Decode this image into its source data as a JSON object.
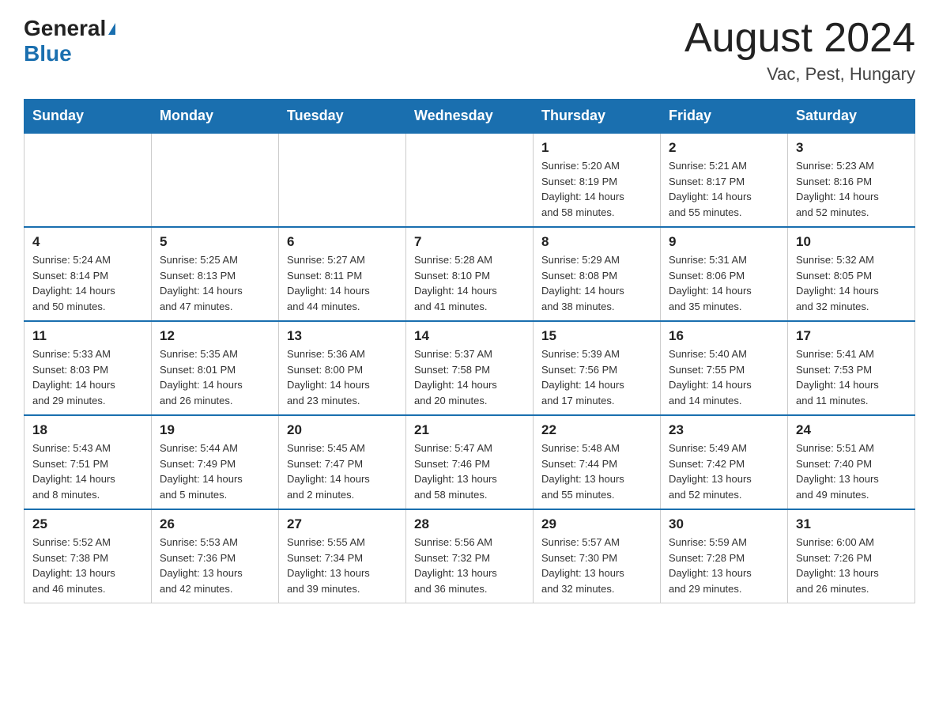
{
  "header": {
    "logo_general": "General",
    "logo_blue": "Blue",
    "month_title": "August 2024",
    "location": "Vac, Pest, Hungary"
  },
  "days_of_week": [
    "Sunday",
    "Monday",
    "Tuesday",
    "Wednesday",
    "Thursday",
    "Friday",
    "Saturday"
  ],
  "weeks": [
    [
      {
        "day": "",
        "info": ""
      },
      {
        "day": "",
        "info": ""
      },
      {
        "day": "",
        "info": ""
      },
      {
        "day": "",
        "info": ""
      },
      {
        "day": "1",
        "info": "Sunrise: 5:20 AM\nSunset: 8:19 PM\nDaylight: 14 hours\nand 58 minutes."
      },
      {
        "day": "2",
        "info": "Sunrise: 5:21 AM\nSunset: 8:17 PM\nDaylight: 14 hours\nand 55 minutes."
      },
      {
        "day": "3",
        "info": "Sunrise: 5:23 AM\nSunset: 8:16 PM\nDaylight: 14 hours\nand 52 minutes."
      }
    ],
    [
      {
        "day": "4",
        "info": "Sunrise: 5:24 AM\nSunset: 8:14 PM\nDaylight: 14 hours\nand 50 minutes."
      },
      {
        "day": "5",
        "info": "Sunrise: 5:25 AM\nSunset: 8:13 PM\nDaylight: 14 hours\nand 47 minutes."
      },
      {
        "day": "6",
        "info": "Sunrise: 5:27 AM\nSunset: 8:11 PM\nDaylight: 14 hours\nand 44 minutes."
      },
      {
        "day": "7",
        "info": "Sunrise: 5:28 AM\nSunset: 8:10 PM\nDaylight: 14 hours\nand 41 minutes."
      },
      {
        "day": "8",
        "info": "Sunrise: 5:29 AM\nSunset: 8:08 PM\nDaylight: 14 hours\nand 38 minutes."
      },
      {
        "day": "9",
        "info": "Sunrise: 5:31 AM\nSunset: 8:06 PM\nDaylight: 14 hours\nand 35 minutes."
      },
      {
        "day": "10",
        "info": "Sunrise: 5:32 AM\nSunset: 8:05 PM\nDaylight: 14 hours\nand 32 minutes."
      }
    ],
    [
      {
        "day": "11",
        "info": "Sunrise: 5:33 AM\nSunset: 8:03 PM\nDaylight: 14 hours\nand 29 minutes."
      },
      {
        "day": "12",
        "info": "Sunrise: 5:35 AM\nSunset: 8:01 PM\nDaylight: 14 hours\nand 26 minutes."
      },
      {
        "day": "13",
        "info": "Sunrise: 5:36 AM\nSunset: 8:00 PM\nDaylight: 14 hours\nand 23 minutes."
      },
      {
        "day": "14",
        "info": "Sunrise: 5:37 AM\nSunset: 7:58 PM\nDaylight: 14 hours\nand 20 minutes."
      },
      {
        "day": "15",
        "info": "Sunrise: 5:39 AM\nSunset: 7:56 PM\nDaylight: 14 hours\nand 17 minutes."
      },
      {
        "day": "16",
        "info": "Sunrise: 5:40 AM\nSunset: 7:55 PM\nDaylight: 14 hours\nand 14 minutes."
      },
      {
        "day": "17",
        "info": "Sunrise: 5:41 AM\nSunset: 7:53 PM\nDaylight: 14 hours\nand 11 minutes."
      }
    ],
    [
      {
        "day": "18",
        "info": "Sunrise: 5:43 AM\nSunset: 7:51 PM\nDaylight: 14 hours\nand 8 minutes."
      },
      {
        "day": "19",
        "info": "Sunrise: 5:44 AM\nSunset: 7:49 PM\nDaylight: 14 hours\nand 5 minutes."
      },
      {
        "day": "20",
        "info": "Sunrise: 5:45 AM\nSunset: 7:47 PM\nDaylight: 14 hours\nand 2 minutes."
      },
      {
        "day": "21",
        "info": "Sunrise: 5:47 AM\nSunset: 7:46 PM\nDaylight: 13 hours\nand 58 minutes."
      },
      {
        "day": "22",
        "info": "Sunrise: 5:48 AM\nSunset: 7:44 PM\nDaylight: 13 hours\nand 55 minutes."
      },
      {
        "day": "23",
        "info": "Sunrise: 5:49 AM\nSunset: 7:42 PM\nDaylight: 13 hours\nand 52 minutes."
      },
      {
        "day": "24",
        "info": "Sunrise: 5:51 AM\nSunset: 7:40 PM\nDaylight: 13 hours\nand 49 minutes."
      }
    ],
    [
      {
        "day": "25",
        "info": "Sunrise: 5:52 AM\nSunset: 7:38 PM\nDaylight: 13 hours\nand 46 minutes."
      },
      {
        "day": "26",
        "info": "Sunrise: 5:53 AM\nSunset: 7:36 PM\nDaylight: 13 hours\nand 42 minutes."
      },
      {
        "day": "27",
        "info": "Sunrise: 5:55 AM\nSunset: 7:34 PM\nDaylight: 13 hours\nand 39 minutes."
      },
      {
        "day": "28",
        "info": "Sunrise: 5:56 AM\nSunset: 7:32 PM\nDaylight: 13 hours\nand 36 minutes."
      },
      {
        "day": "29",
        "info": "Sunrise: 5:57 AM\nSunset: 7:30 PM\nDaylight: 13 hours\nand 32 minutes."
      },
      {
        "day": "30",
        "info": "Sunrise: 5:59 AM\nSunset: 7:28 PM\nDaylight: 13 hours\nand 29 minutes."
      },
      {
        "day": "31",
        "info": "Sunrise: 6:00 AM\nSunset: 7:26 PM\nDaylight: 13 hours\nand 26 minutes."
      }
    ]
  ]
}
